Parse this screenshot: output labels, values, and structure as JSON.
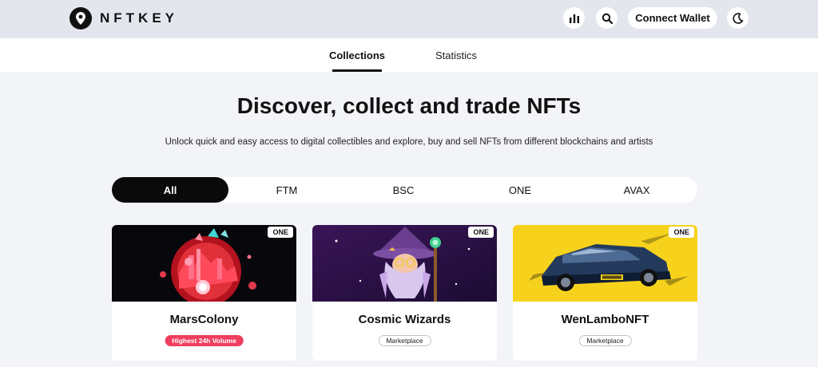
{
  "header": {
    "logo_text": "NFTKEY",
    "stats_icon": "bar-chart-icon",
    "search_icon": "search-icon",
    "connect_label": "Connect Wallet",
    "theme_icon": "moon-icon"
  },
  "tabs": [
    {
      "label": "Collections",
      "active": true
    },
    {
      "label": "Statistics",
      "active": false
    }
  ],
  "hero": {
    "title": "Discover, collect and trade NFTs",
    "subtitle": "Unlock quick and easy access to digital collectibles and explore, buy and sell NFTs from different blockchains and artists"
  },
  "chains": [
    {
      "label": "All",
      "active": true
    },
    {
      "label": "FTM",
      "active": false
    },
    {
      "label": "BSC",
      "active": false
    },
    {
      "label": "ONE",
      "active": false
    },
    {
      "label": "AVAX",
      "active": false
    }
  ],
  "cards": [
    {
      "title": "MarsColony",
      "chain": "ONE",
      "tag": "Highest 24h Volume",
      "tag_style": "hot"
    },
    {
      "title": "Cosmic Wizards",
      "chain": "ONE",
      "tag": "Marketplace",
      "tag_style": "plain"
    },
    {
      "title": "WenLamboNFT",
      "chain": "ONE",
      "tag": "Marketplace",
      "tag_style": "plain"
    }
  ],
  "colors": {
    "header_bg": "#e4e6ee",
    "page_bg": "#f3f4f8",
    "accent_dark": "#0a0a0a",
    "hot_tag": "#ef3e5e",
    "lambo_bg": "#f7d21c"
  }
}
